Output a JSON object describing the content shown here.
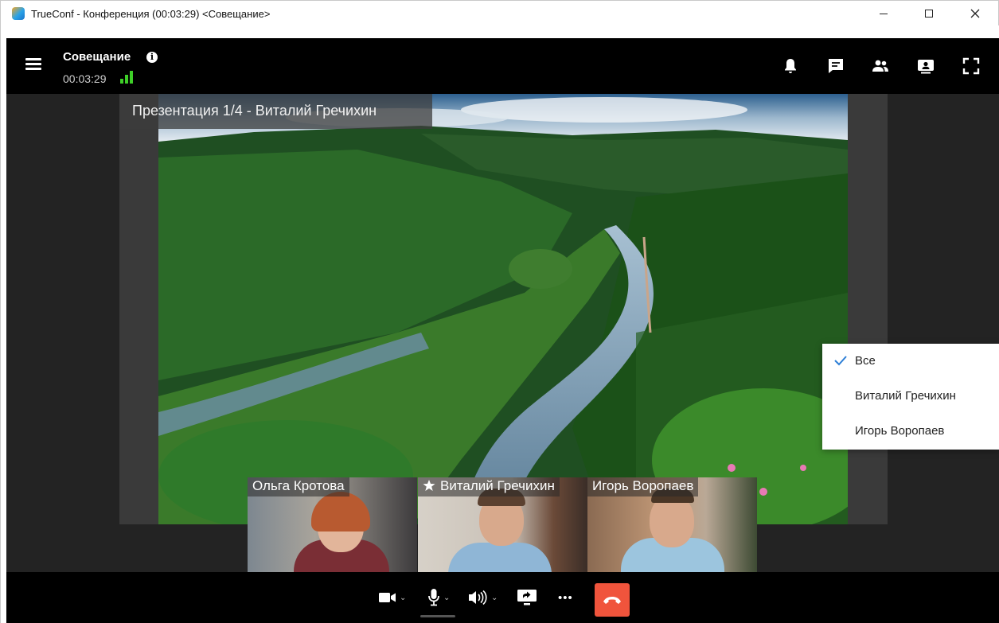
{
  "window": {
    "title": "TrueConf - Конференция (00:03:29) <Совещание>"
  },
  "header": {
    "conference_name": "Совещание",
    "info_glyph": "i",
    "timer": "00:03:29",
    "icons": [
      "bell-icon",
      "chat-icon",
      "participants-icon",
      "layout-icon",
      "fullscreen-icon"
    ]
  },
  "presentation": {
    "caption": "Презентация 1/4 - Виталий Гречихин"
  },
  "dropdown": {
    "items": [
      {
        "label": "Все",
        "checked": true
      },
      {
        "label": "Виталий Гречихин",
        "checked": false
      },
      {
        "label": "Игорь Воропаев",
        "checked": false
      }
    ]
  },
  "participants": [
    {
      "name": "Ольга Кротова",
      "speaker": false
    },
    {
      "name": "Виталий Гречихин",
      "speaker": true
    },
    {
      "name": "Игорь Воропаев",
      "speaker": false
    }
  ],
  "controls": {
    "icons": [
      "camera-icon",
      "microphone-icon",
      "speaker-icon",
      "share-screen-icon",
      "more-icon",
      "hangup-icon"
    ],
    "more_glyph": "•••",
    "chevron_glyph": "⌄"
  },
  "colors": {
    "hangup": "#f0543c",
    "signal": "#3ecf28",
    "header_bg": "#000000",
    "stage_bg": "#232323"
  }
}
